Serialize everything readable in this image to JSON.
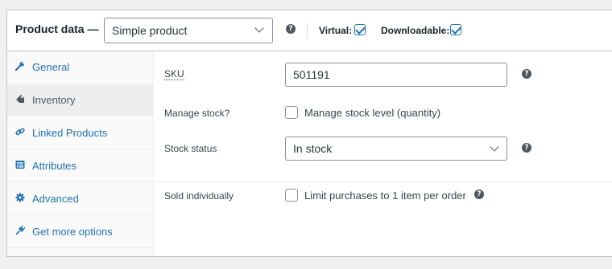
{
  "header": {
    "title": "Product data —",
    "product_type": "Simple product",
    "virtual_label": "Virtual:",
    "virtual_checked": true,
    "downloadable_label": "Downloadable:",
    "downloadable_checked": true
  },
  "tabs": [
    {
      "label": "General",
      "icon": "wrench-icon",
      "active": false
    },
    {
      "label": "Inventory",
      "icon": "tag-icon",
      "active": true
    },
    {
      "label": "Linked Products",
      "icon": "link-icon",
      "active": false
    },
    {
      "label": "Attributes",
      "icon": "table-icon",
      "active": false
    },
    {
      "label": "Advanced",
      "icon": "gear-icon",
      "active": false
    },
    {
      "label": "Get more options",
      "icon": "plugin-icon",
      "active": false
    }
  ],
  "inventory": {
    "sku_label": "SKU",
    "sku_value": "501191",
    "manage_stock_label": "Manage stock?",
    "manage_stock_text": "Manage stock level (quantity)",
    "stock_status_label": "Stock status",
    "stock_status_value": "In stock",
    "sold_individually_label": "Sold individually",
    "sold_individually_text": "Limit purchases to 1 item per order"
  },
  "colors": {
    "accent": "#2271b1",
    "active_tab_bg": "#eeeeee",
    "border": "#c3c4c7"
  }
}
